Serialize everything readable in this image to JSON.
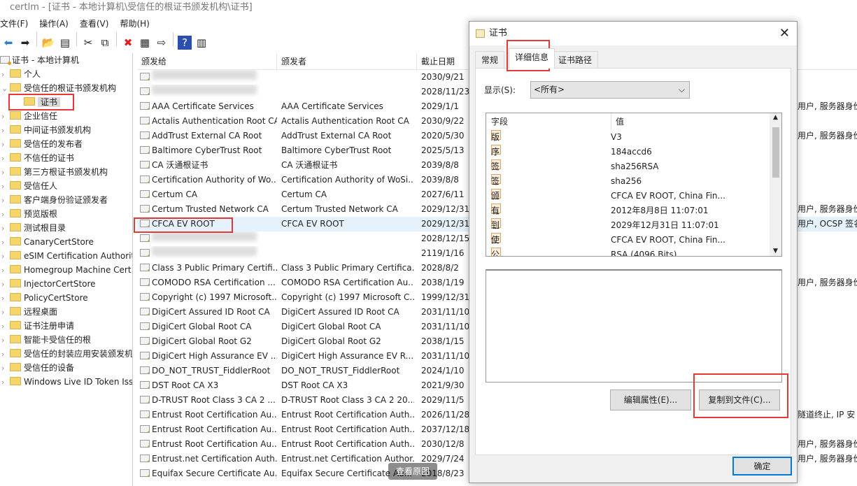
{
  "window": {
    "title": "certlm - [证书 - 本地计算机\\受信任的根证书颁发机构\\证书]"
  },
  "menu": [
    "文件(F)",
    "操作(A)",
    "查看(V)",
    "帮助(H)"
  ],
  "toolbar": [
    "back-icon",
    "forward-icon",
    "up-folder-icon",
    "show-tree-icon",
    "cut-icon",
    "copy-icon",
    "delete-icon",
    "properties-icon",
    "export-icon",
    "help-icon",
    "action-pane-icon"
  ],
  "tree": {
    "root": "证书 - 本地计算机",
    "items": [
      {
        "label": "个人",
        "level": 1,
        "expanded": false
      },
      {
        "label": "受信任的根证书颁发机构",
        "level": 1,
        "expanded": true
      },
      {
        "label": "证书",
        "level": 2,
        "selected": true
      },
      {
        "label": "企业信任",
        "level": 1
      },
      {
        "label": "中间证书颁发机构",
        "level": 1
      },
      {
        "label": "受信任的发布者",
        "level": 1
      },
      {
        "label": "不信任的证书",
        "level": 1
      },
      {
        "label": "第三方根证书颁发机构",
        "level": 1
      },
      {
        "label": "受信任人",
        "level": 1
      },
      {
        "label": "客户端身份验证颁发者",
        "level": 1
      },
      {
        "label": "预览版根",
        "level": 1
      },
      {
        "label": "测试根目录",
        "level": 1
      },
      {
        "label": "CanaryCertStore",
        "level": 1
      },
      {
        "label": "eSIM Certification Authorit",
        "level": 1
      },
      {
        "label": "Homegroup Machine Cert",
        "level": 1
      },
      {
        "label": "InjectorCertStore",
        "level": 1
      },
      {
        "label": "PolicyCertStore",
        "level": 1
      },
      {
        "label": "远程桌面",
        "level": 1
      },
      {
        "label": "证书注册申请",
        "level": 1
      },
      {
        "label": "智能卡受信任的根",
        "level": 1
      },
      {
        "label": "受信任的封装应用安装颁发机",
        "level": 1
      },
      {
        "label": "受信任的设备",
        "level": 1
      },
      {
        "label": "Windows Live ID Token Iss",
        "level": 1
      }
    ]
  },
  "list": {
    "columns": [
      "颁发给",
      "颁发者",
      "截止日期"
    ],
    "rows": [
      {
        "to": "",
        "by": "",
        "exp": "2030/9/21",
        "purpose": "",
        "blur": true
      },
      {
        "to": "",
        "by": "",
        "exp": "2028/11/23",
        "purpose": "",
        "blur": true
      },
      {
        "to": "AAA Certificate Services",
        "by": "AAA Certificate Services",
        "exp": "2029/1/1",
        "purpose": "用户, 服务器身份"
      },
      {
        "to": "Actalis Authentication Root CA",
        "by": "Actalis Authentication Root CA",
        "exp": "2030/9/22",
        "purpose": ""
      },
      {
        "to": "AddTrust External CA Root",
        "by": "AddTrust External CA Root",
        "exp": "2020/5/30",
        "purpose": "用户, 服务器身份"
      },
      {
        "to": "Baltimore CyberTrust Root",
        "by": "Baltimore CyberTrust Root",
        "exp": "2025/5/13",
        "purpose": ""
      },
      {
        "to": "CA 沃通根证书",
        "by": "CA 沃通根证书",
        "exp": "2039/8/8",
        "purpose": ""
      },
      {
        "to": "Certification Authority of Wo...",
        "by": "Certification Authority of WoSi...",
        "exp": "2039/8/8",
        "purpose": ""
      },
      {
        "to": "Certum CA",
        "by": "Certum CA",
        "exp": "2027/6/11",
        "purpose": ""
      },
      {
        "to": "Certum Trusted Network CA",
        "by": "Certum Trusted Network CA",
        "exp": "2029/12/31",
        "purpose": "用户, 服务器身份"
      },
      {
        "to": "CFCA EV ROOT",
        "by": "CFCA EV ROOT",
        "exp": "2029/12/31",
        "purpose": "用户, OCSP 签名",
        "selected": true
      },
      {
        "to": "",
        "by": "",
        "exp": "2028/12/15",
        "purpose": "",
        "blur": true
      },
      {
        "to": "",
        "by": "",
        "exp": "2119/1/16",
        "purpose": "",
        "blur": true
      },
      {
        "to": "Class 3 Public Primary Certifi...",
        "by": "Class 3 Public Primary Certifica...",
        "exp": "2028/8/2",
        "purpose": ""
      },
      {
        "to": "COMODO RSA Certification ...",
        "by": "COMODO RSA Certification Au...",
        "exp": "2038/1/19",
        "purpose": "用户, 服务器身份"
      },
      {
        "to": "Copyright (c) 1997 Microsoft...",
        "by": "Copyright (c) 1997 Microsoft C...",
        "exp": "1999/12/31",
        "purpose": ""
      },
      {
        "to": "DigiCert Assured ID Root CA",
        "by": "DigiCert Assured ID Root CA",
        "exp": "2031/11/10",
        "purpose": ""
      },
      {
        "to": "DigiCert Global Root CA",
        "by": "DigiCert Global Root CA",
        "exp": "2031/11/10",
        "purpose": ""
      },
      {
        "to": "DigiCert Global Root G2",
        "by": "DigiCert Global Root G2",
        "exp": "2038/1/15",
        "purpose": ""
      },
      {
        "to": "DigiCert High Assurance EV ...",
        "by": "DigiCert High Assurance EV R...",
        "exp": "2031/11/10",
        "purpose": ""
      },
      {
        "to": "DO_NOT_TRUST_FiddlerRoot",
        "by": "DO_NOT_TRUST_FiddlerRoot",
        "exp": "2024/1/10",
        "purpose": ""
      },
      {
        "to": "DST Root CA X3",
        "by": "DST Root CA X3",
        "exp": "2021/9/30",
        "purpose": ""
      },
      {
        "to": "D-TRUST Root Class 3 CA 2 ...",
        "by": "D-TRUST Root Class 3 CA 2 20...",
        "exp": "2029/11/5",
        "purpose": ""
      },
      {
        "to": "Entrust Root Certification Au...",
        "by": "Entrust Root Certification Auth...",
        "exp": "2026/11/28",
        "purpose": "隧道终止, IP 安"
      },
      {
        "to": "Entrust Root Certification Au...",
        "by": "Entrust Root Certification Auth...",
        "exp": "2037/12/18",
        "purpose": ""
      },
      {
        "to": "Entrust Root Certification Au...",
        "by": "Entrust Root Certification Auth...",
        "exp": "2030/12/8",
        "purpose": "用户, 服务器身份"
      },
      {
        "to": "Entrust.net Certification Auth...",
        "by": "Entrust.net Certification Author...",
        "exp": "2029/7/24",
        "purpose": "用户, 服务器身份"
      },
      {
        "to": "Equifax Secure Certificate Au...",
        "by": "Equifax Secure Certificate Au...",
        "exp": "2018/8/23",
        "purpose": ""
      }
    ]
  },
  "watermark": "查看原图",
  "dialog": {
    "title": "证书",
    "tabs": [
      "常规",
      "详细信息",
      "证书路径"
    ],
    "active_tab": 1,
    "show_label": "显示(S):",
    "show_value": "<所有>",
    "field_columns": [
      "字段",
      "值"
    ],
    "fields": [
      {
        "name": "版本",
        "value": "V3"
      },
      {
        "name": "序列号",
        "value": "184accd6"
      },
      {
        "name": "签名算法",
        "value": "sha256RSA"
      },
      {
        "name": "签名哈希算法",
        "value": "sha256"
      },
      {
        "name": "颁发者",
        "value": "CFCA EV ROOT, China Fin..."
      },
      {
        "name": "有效期从",
        "value": "2012年8月8日 11:07:01"
      },
      {
        "name": "到",
        "value": "2029年12月31日 11:07:01"
      },
      {
        "name": "使用者",
        "value": "CFCA EV ROOT, China Fin..."
      },
      {
        "name": "公钥",
        "value": "RSA (4096 Bits)"
      }
    ],
    "edit_button": "编辑属性(E)...",
    "copy_button": "复制到文件(C)...",
    "ok_button": "确定"
  },
  "colors": {
    "highlight": "#e53935",
    "accent": "#0078d7"
  }
}
